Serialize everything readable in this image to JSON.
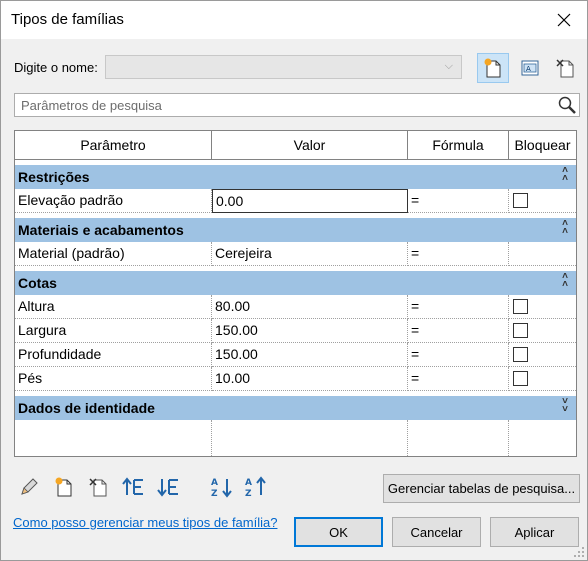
{
  "window": {
    "title": "Tipos de famílias"
  },
  "name_row": {
    "label": "Digite o nome:",
    "value": ""
  },
  "search": {
    "placeholder": "Parâmetros de pesquisa"
  },
  "grid": {
    "headers": [
      "Parâmetro",
      "Valor",
      "Fórmula",
      "Bloquear"
    ],
    "groups": [
      {
        "title": "Restrições",
        "collapsed": false,
        "rows": [
          {
            "param": "Elevação padrão",
            "value": "0.00",
            "formula": "=",
            "lock": true
          }
        ]
      },
      {
        "title": "Materiais e acabamentos",
        "collapsed": false,
        "rows": [
          {
            "param": "Material (padrão)",
            "value": "Cerejeira",
            "formula": "=",
            "lock": false
          }
        ]
      },
      {
        "title": "Cotas",
        "collapsed": false,
        "rows": [
          {
            "param": "Altura",
            "value": "80.00",
            "formula": "=",
            "lock": true
          },
          {
            "param": "Largura",
            "value": "150.00",
            "formula": "=",
            "lock": true
          },
          {
            "param": "Profundidade",
            "value": "150.00",
            "formula": "=",
            "lock": true
          },
          {
            "param": "Pés",
            "value": "10.00",
            "formula": "=",
            "lock": true
          }
        ]
      },
      {
        "title": "Dados de identidade",
        "collapsed": true,
        "rows": []
      }
    ]
  },
  "buttons": {
    "manage_lookup": "Gerenciar tabelas de pesquisa...",
    "ok": "OK",
    "cancel": "Cancelar",
    "apply": "Aplicar"
  },
  "help_link": "Como posso gerenciar meus tipos de família?",
  "colors": {
    "group_band": "#9ec2e3",
    "accent": "#0078d7",
    "link": "#0066cc"
  }
}
